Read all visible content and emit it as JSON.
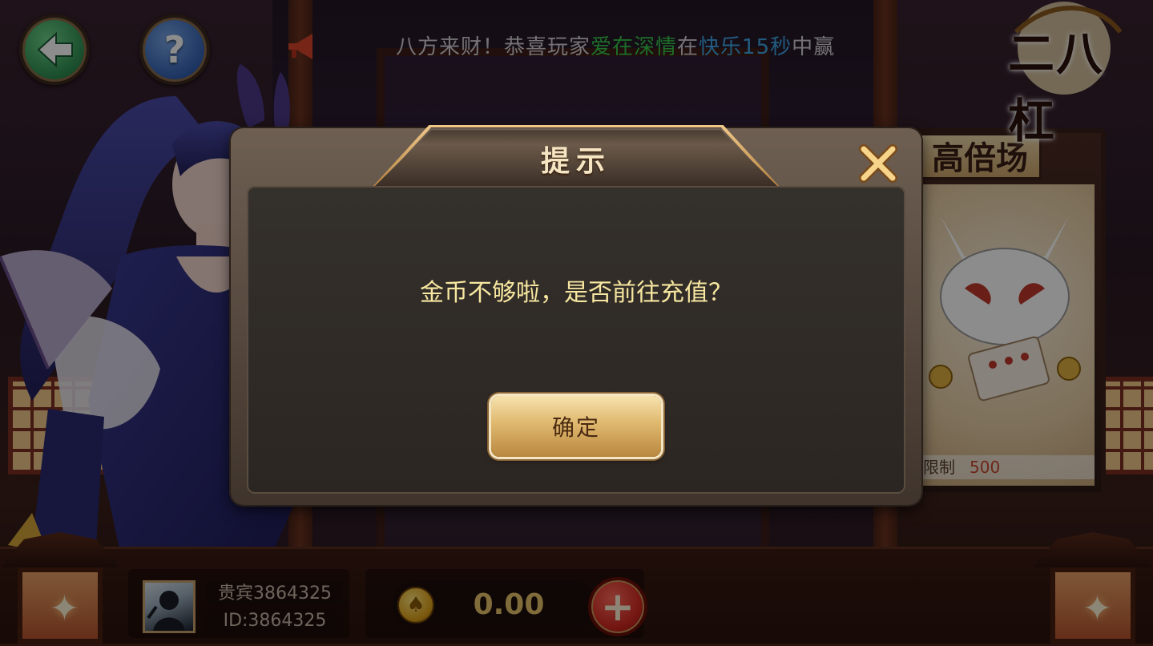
{
  "top_bar": {
    "back_button_label": "back",
    "help_button_label": "?",
    "marquee": {
      "prefix": "八方来财！恭喜玩家",
      "player_name": "爱在深情",
      "mid": "在",
      "game_name": "快乐15秒",
      "suffix": "中赢"
    },
    "logo_text": "二八杠"
  },
  "room_card": {
    "title": "高倍场",
    "limit_label": "限制",
    "limit_value": "500"
  },
  "dialog": {
    "title": "提示",
    "message": "金币不够啦，是否前往充值？",
    "confirm_label": "确定"
  },
  "player": {
    "nickname": "贵宾3864325",
    "id_text": "ID:3864325"
  },
  "wallet": {
    "gold_amount": "0.00",
    "recharge_label": "+"
  },
  "colors": {
    "marquee_player": "#35c64a",
    "marquee_game": "#3ea6e8",
    "dialog_message": "#f7e7a0",
    "gold_amount": "#e9c36a"
  }
}
